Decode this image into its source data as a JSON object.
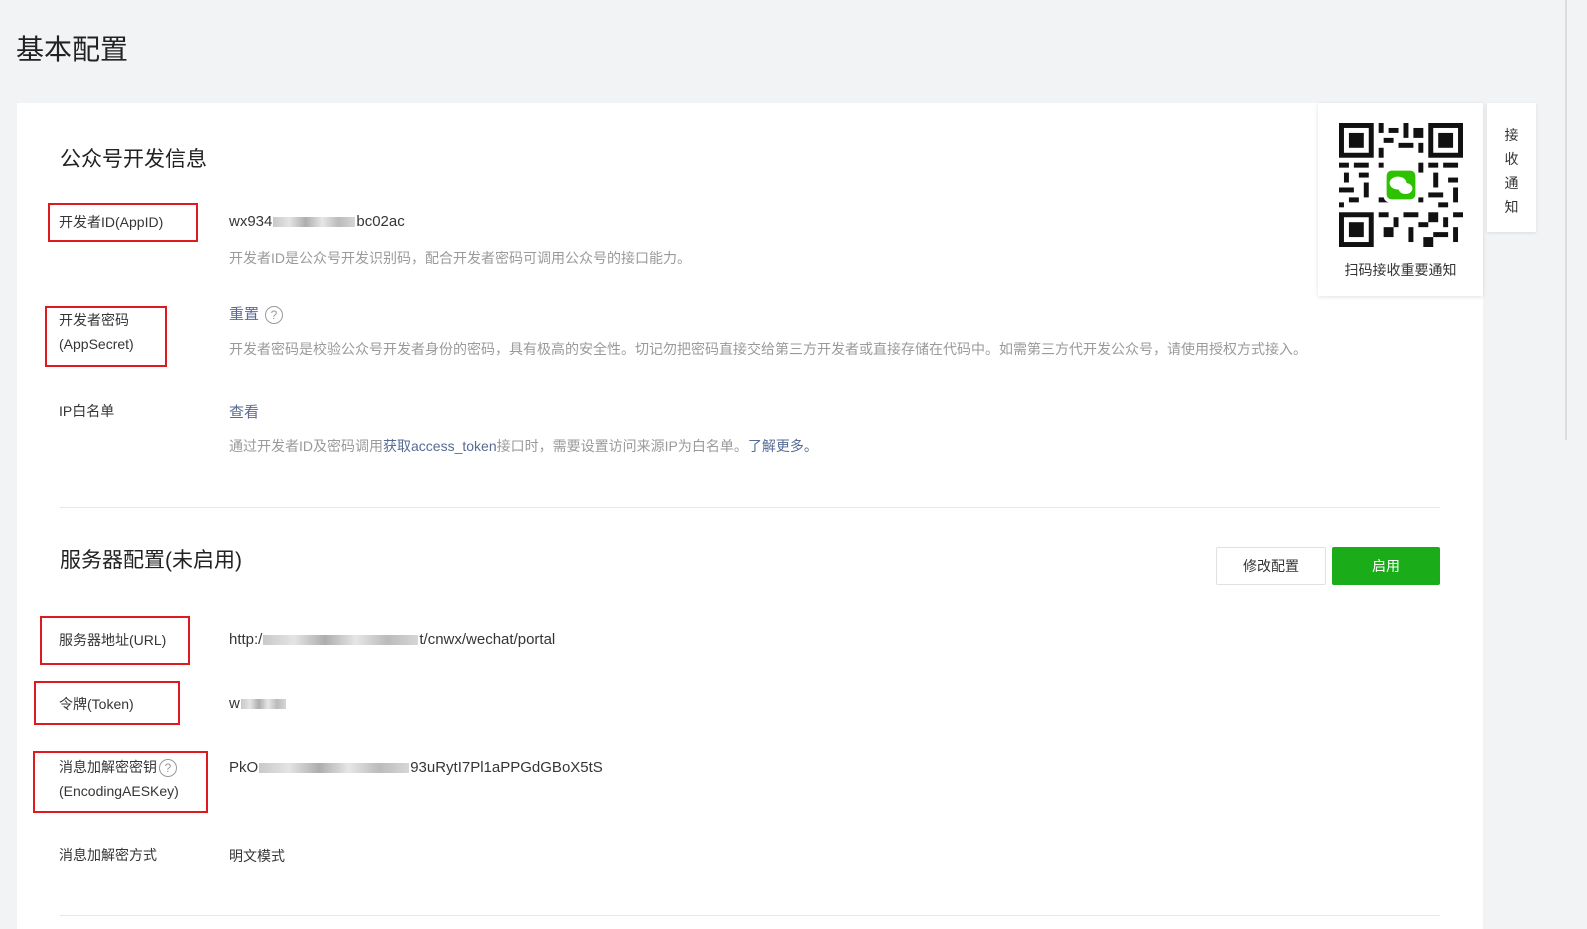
{
  "page": {
    "title": "基本配置"
  },
  "dev_info": {
    "title": "公众号开发信息",
    "appid": {
      "label": "开发者ID(AppID)",
      "value_prefix": "wx934",
      "value_suffix": "bc02ac",
      "desc": "开发者ID是公众号开发识别码，配合开发者密码可调用公众号的接口能力。"
    },
    "secret": {
      "label_line1": "开发者密码",
      "label_line2": "(AppSecret)",
      "action": "重置",
      "help": "?",
      "desc": "开发者密码是校验公众号开发者身份的密码，具有极高的安全性。切记勿把密码直接交给第三方开发者或直接存储在代码中。如需第三方代开发公众号，请使用授权方式接入。"
    },
    "ip": {
      "label": "IP白名单",
      "action": "查看",
      "desc_part1": "通过开发者ID及密码调用",
      "desc_link": "获取access_token",
      "desc_part2": "接口时，需要设置访问来源IP为白名单。",
      "desc_more": "了解更多。"
    }
  },
  "server": {
    "title": "服务器配置(未启用)",
    "modify_button": "修改配置",
    "enable_button": "启用",
    "url": {
      "label": "服务器地址(URL)",
      "value_prefix": "http:/",
      "value_suffix": "t/cnwx/wechat/portal"
    },
    "token": {
      "label": "令牌(Token)",
      "value_prefix": "w"
    },
    "aeskey": {
      "label_line1": "消息加解密密钥",
      "label_line2": "(EncodingAESKey)",
      "help": "?",
      "value_prefix": "PkO",
      "value_suffix": "93uRytI7Pl1aPPGdGBoX5tS"
    },
    "mode": {
      "label": "消息加解密方式",
      "value": "明文模式"
    }
  },
  "qr": {
    "caption": "扫码接收重要通知"
  },
  "notify_tab": {
    "chars": [
      "接",
      "收",
      "通",
      "知"
    ]
  },
  "colors": {
    "accent_green": "#1aad19",
    "link_blue": "#576b95",
    "highlight_red": "#e0191f"
  }
}
